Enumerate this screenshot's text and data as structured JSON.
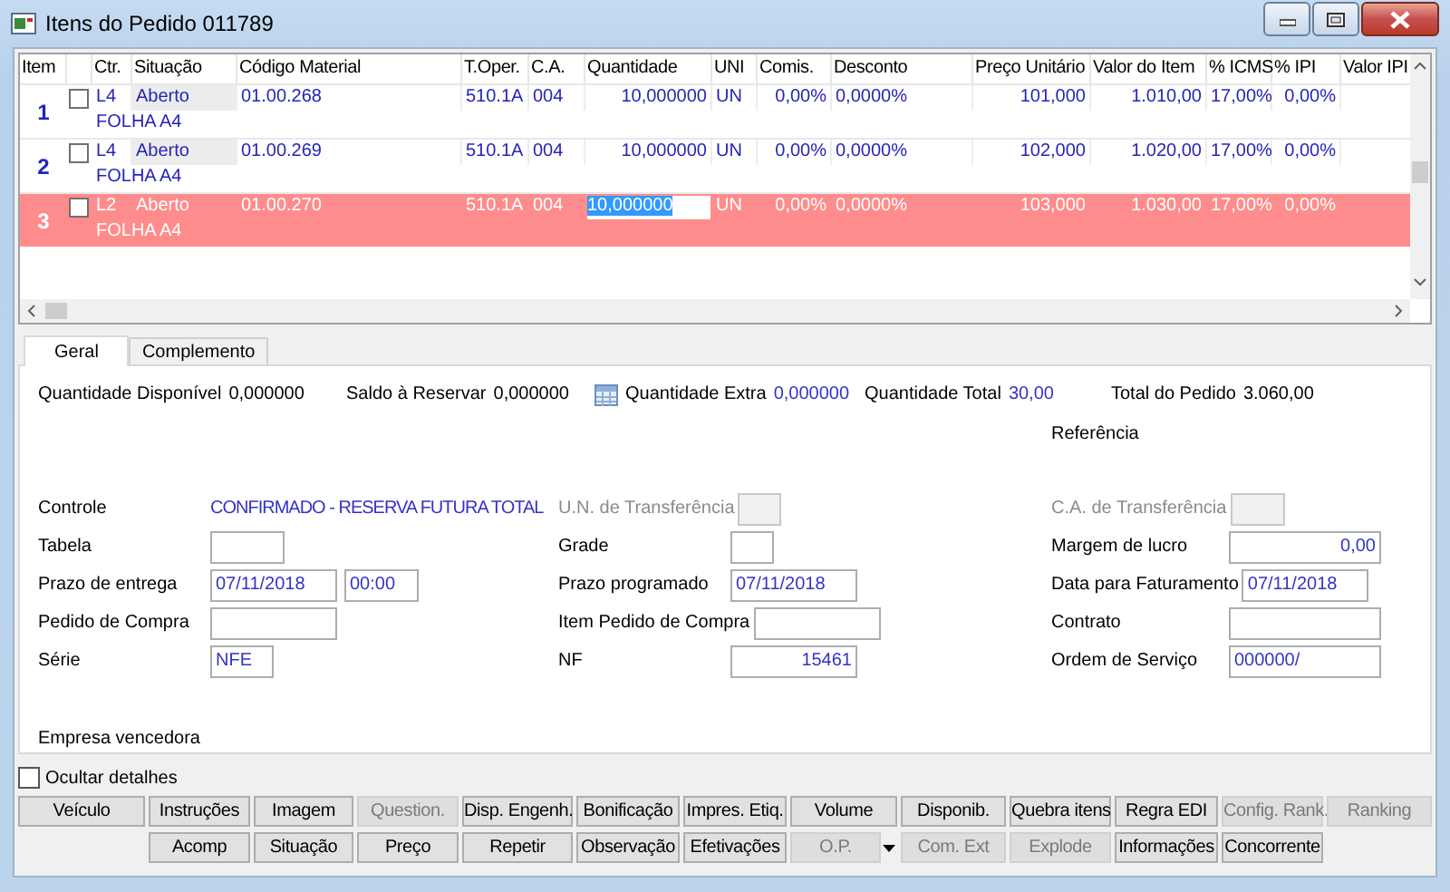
{
  "window": {
    "title": "Itens do Pedido 011789"
  },
  "grid": {
    "columns": [
      "Item",
      "Ctr.",
      "Situação",
      "Código Material",
      "T.Oper.",
      "C.A.",
      "Quantidade",
      "UNI",
      "Comis.",
      "Desconto",
      "Preço Unitário",
      "Valor do Item",
      "% ICMS",
      "% IPI",
      "Valor IPI"
    ],
    "rows": [
      {
        "checked": false,
        "selected": false,
        "editing": false,
        "cells": [
          "1",
          "L4",
          "Aberto",
          "01.00.268",
          "510.1A",
          "004",
          "10,000000",
          "UN",
          "0,00%",
          "0,0000%",
          "101,000",
          "1.010,00",
          "17,00%",
          "0,00%"
        ],
        "description": "FOLHA A4"
      },
      {
        "checked": false,
        "selected": false,
        "editing": false,
        "cells": [
          "2",
          "L4",
          "Aberto",
          "01.00.269",
          "510.1A",
          "004",
          "10,000000",
          "UN",
          "0,00%",
          "0,0000%",
          "102,000",
          "1.020,00",
          "17,00%",
          "0,00%"
        ],
        "description": "FOLHA A4"
      },
      {
        "checked": false,
        "selected": true,
        "editing": true,
        "cells": [
          "3",
          "L2",
          "Aberto",
          "01.00.270",
          "510.1A",
          "004",
          "10,000000",
          "UN",
          "0,00%",
          "0,0000%",
          "103,000",
          "1.030,00",
          "17,00%",
          "0,00%"
        ],
        "description": "FOLHA A4"
      }
    ]
  },
  "tabs": [
    {
      "label": "Geral",
      "selected": true
    },
    {
      "label": "Complemento",
      "selected": false
    }
  ],
  "summary": [
    {
      "label": "Quantidade Disponível",
      "value": "0,000000",
      "kind": "plain",
      "highlighted": false
    },
    {
      "label": "Saldo à Reservar",
      "value": "0,000000",
      "kind": "plain",
      "highlighted": false
    },
    {
      "label": "Quantidade Extra",
      "value": "0,000000",
      "kind": "icon",
      "highlighted": true
    },
    {
      "label": "Quantidade Total",
      "value": "30,00",
      "kind": "plain",
      "highlighted": true
    },
    {
      "label": "Total do Pedido",
      "value": "3.060,00",
      "kind": "plain",
      "highlighted": false
    }
  ],
  "reference_label": "Referência",
  "form": [
    [
      {
        "label": "Controle",
        "kind": "text",
        "value": "CONFIRMADO - RESERVA FUTURA TOTAL",
        "disabled": false
      },
      {
        "label": "U.N. de Transferência",
        "kind": "fields",
        "disabled": true,
        "fields": [
          {
            "disabled": true
          }
        ]
      },
      {
        "label": "C.A. de Transferência",
        "kind": "fields",
        "disabled": true,
        "fields": [
          {
            "disabled": true
          }
        ]
      }
    ],
    [
      {
        "label": "Tabela",
        "kind": "fields",
        "disabled": false,
        "fields": [
          {
            "disabled": false
          }
        ]
      },
      {
        "label": "Grade",
        "kind": "fields",
        "disabled": false,
        "fields": [
          {
            "disabled": false
          }
        ]
      },
      {
        "label": "Margem de lucro",
        "kind": "fields",
        "disabled": false,
        "fields": [
          {
            "value": "0,00",
            "numeric": true
          }
        ]
      }
    ],
    [
      {
        "label": "Prazo de entrega",
        "kind": "fields",
        "disabled": false,
        "fields": [
          {
            "value": "07/11/2018"
          },
          {
            "value": "00:00"
          }
        ]
      },
      {
        "label": "Prazo programado",
        "kind": "fields",
        "disabled": false,
        "fields": [
          {
            "value": "07/11/2018"
          }
        ]
      },
      {
        "label": "Data para Faturamento",
        "kind": "fields",
        "disabled": false,
        "fields": [
          {
            "value": "07/11/2018"
          }
        ]
      }
    ],
    [
      {
        "label": "Pedido de Compra",
        "kind": "fields",
        "disabled": false,
        "fields": [
          {
            "disabled": false
          }
        ]
      },
      {
        "label": "Item Pedido de Compra",
        "kind": "fields",
        "disabled": false,
        "fields": [
          {
            "disabled": false
          }
        ]
      },
      {
        "label": "Contrato",
        "kind": "fields",
        "disabled": false,
        "fields": [
          {
            "disabled": false
          }
        ]
      }
    ],
    [
      {
        "label": "Série",
        "kind": "fields",
        "disabled": false,
        "fields": [
          {
            "value": "NFE"
          }
        ]
      },
      {
        "label": "NF",
        "kind": "fields",
        "disabled": false,
        "fields": [
          {
            "value": "15461",
            "numeric": true
          }
        ]
      },
      {
        "label": "Ordem de Serviço",
        "kind": "fields",
        "disabled": false,
        "fields": [
          {
            "value": "000000/"
          }
        ]
      }
    ]
  ],
  "winner_label": "Empresa vencedora",
  "hide_details": {
    "label": "Ocultar detalhes",
    "checked": false
  },
  "buttons": [
    [
      {
        "label": "Veículo",
        "disabled": false,
        "kind": "plain"
      },
      {
        "label": "Instruções",
        "disabled": false,
        "kind": "plain"
      },
      {
        "label": "Imagem",
        "disabled": false,
        "kind": "plain"
      },
      {
        "label": "Question.",
        "disabled": true,
        "kind": "plain"
      },
      {
        "label": "Disp. Engenh.",
        "disabled": false,
        "kind": "plain"
      },
      {
        "label": "Bonificação",
        "disabled": false,
        "kind": "plain"
      },
      {
        "label": "Impres. Etiq.",
        "disabled": false,
        "kind": "plain"
      },
      {
        "label": "Volume",
        "disabled": false,
        "kind": "plain"
      },
      {
        "label": "Disponib.",
        "disabled": false,
        "kind": "plain"
      },
      {
        "label": "Quebra itens",
        "disabled": false,
        "kind": "plain"
      },
      {
        "label": "Regra EDI",
        "disabled": false,
        "kind": "plain"
      },
      {
        "label": "Config. Rank.",
        "disabled": true,
        "kind": "plain"
      },
      {
        "label": "Ranking",
        "disabled": true,
        "kind": "plain"
      }
    ],
    [
      {
        "label": "Acomp",
        "disabled": false,
        "kind": "plain"
      },
      {
        "label": "Situação",
        "disabled": false,
        "kind": "plain"
      },
      {
        "label": "Preço",
        "disabled": false,
        "kind": "plain"
      },
      {
        "label": "Repetir",
        "disabled": false,
        "kind": "plain"
      },
      {
        "label": "Observação",
        "disabled": false,
        "kind": "plain"
      },
      {
        "label": "Efetivações",
        "disabled": false,
        "kind": "plain"
      },
      {
        "label": "O.P.",
        "disabled": true,
        "kind": "split"
      },
      {
        "label": "Com. Ext",
        "disabled": true,
        "kind": "plain"
      },
      {
        "label": "Explode",
        "disabled": true,
        "kind": "plain"
      },
      {
        "label": "Informações",
        "disabled": false,
        "kind": "plain"
      },
      {
        "label": "Concorrente",
        "disabled": false,
        "kind": "plain"
      }
    ]
  ]
}
